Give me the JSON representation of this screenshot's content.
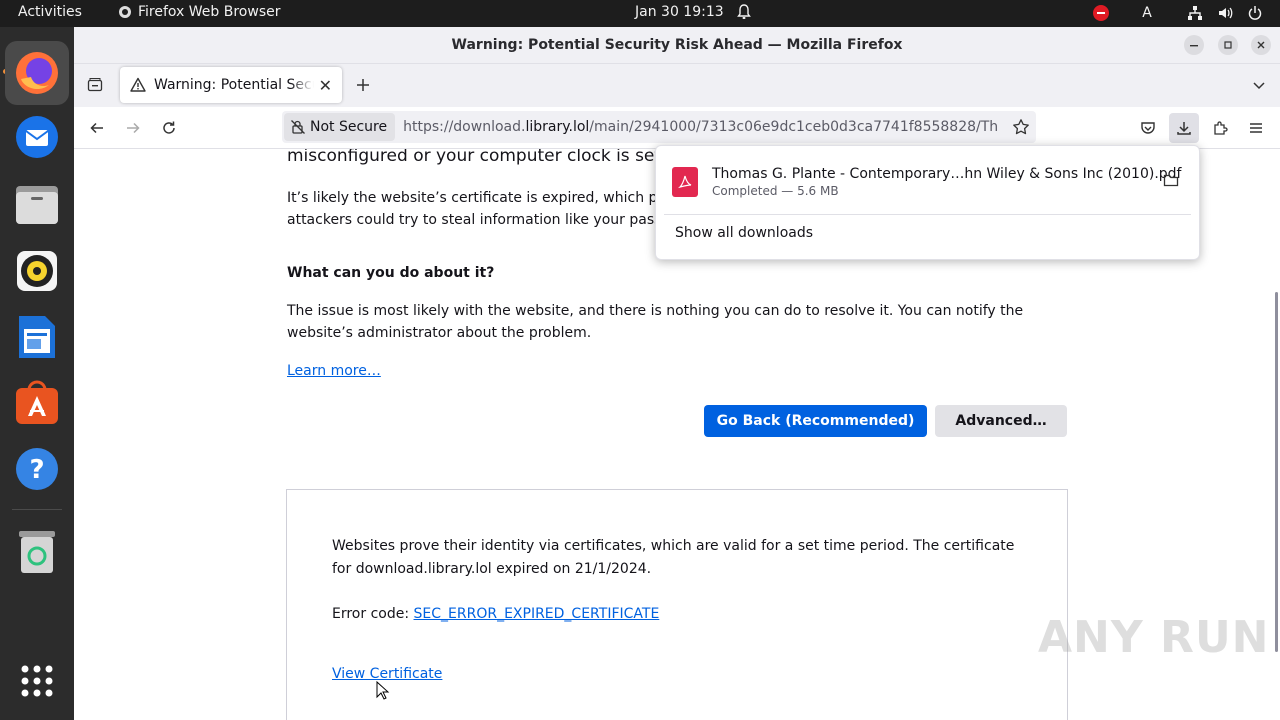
{
  "topbar": {
    "activities": "Activities",
    "app_name": "Firefox Web Browser",
    "clock": "Jan 30  19:13",
    "keyboard_indicator": "A"
  },
  "dock": {
    "items": [
      {
        "name": "firefox-icon",
        "color": "#ff7139"
      },
      {
        "name": "thunderbird-icon",
        "color": "#1a73e8"
      },
      {
        "name": "files-icon",
        "color": "#e8e8e8"
      },
      {
        "name": "rhythmbox-icon",
        "color": "#f6d32d"
      },
      {
        "name": "writer-icon",
        "color": "#1c71d8"
      },
      {
        "name": "app-center-icon",
        "color": "#e95420"
      },
      {
        "name": "help-icon",
        "color": "#3584e4"
      },
      {
        "name": "trash-icon",
        "color": "#8a8a8a"
      },
      {
        "name": "show-apps-icon",
        "color": "#ffffff"
      }
    ]
  },
  "window": {
    "title": "Warning: Potential Security Risk Ahead — Mozilla Firefox"
  },
  "tab": {
    "label": "Warning: Potential Security Risk Ahead"
  },
  "navbar": {
    "not_secure": "Not Secure",
    "url_prefix": "https://download.",
    "url_domain": "library.lol",
    "url_rest": "/main/2941000/7313c06e9dc1ceb0d3ca7741f8558828/Th"
  },
  "content": {
    "cutoff_line": "misconfigured or your computer clock is set to t",
    "para_expired": "It’s likely the website’s certificate is expired, which pre",
    "para_expired_2": "attackers could try to steal information like your passw",
    "heading": "What can you do about it?",
    "para_issue": "The issue is most likely with the website, and there is nothing you can do to resolve it. You can notify the website’s administrator about the problem.",
    "learn_more": "Learn more…",
    "go_back": "Go Back (Recommended)",
    "advanced": "Advanced…",
    "adv_text": "Websites prove their identity via certificates, which are valid for a set time period. The certificate for download.library.lol expired on 21/1/2024.",
    "error_code_label": "Error code: ",
    "error_code": "SEC_ERROR_EXPIRED_CERTIFICATE",
    "view_certificate": "View Certificate"
  },
  "downloads": {
    "file_name": "Thomas G. Plante - Contemporary…hn Wiley & Sons Inc (2010).pdf",
    "status": "Completed — 5.6 MB",
    "show_all": "Show all downloads"
  },
  "watermark": "ANY RUN"
}
